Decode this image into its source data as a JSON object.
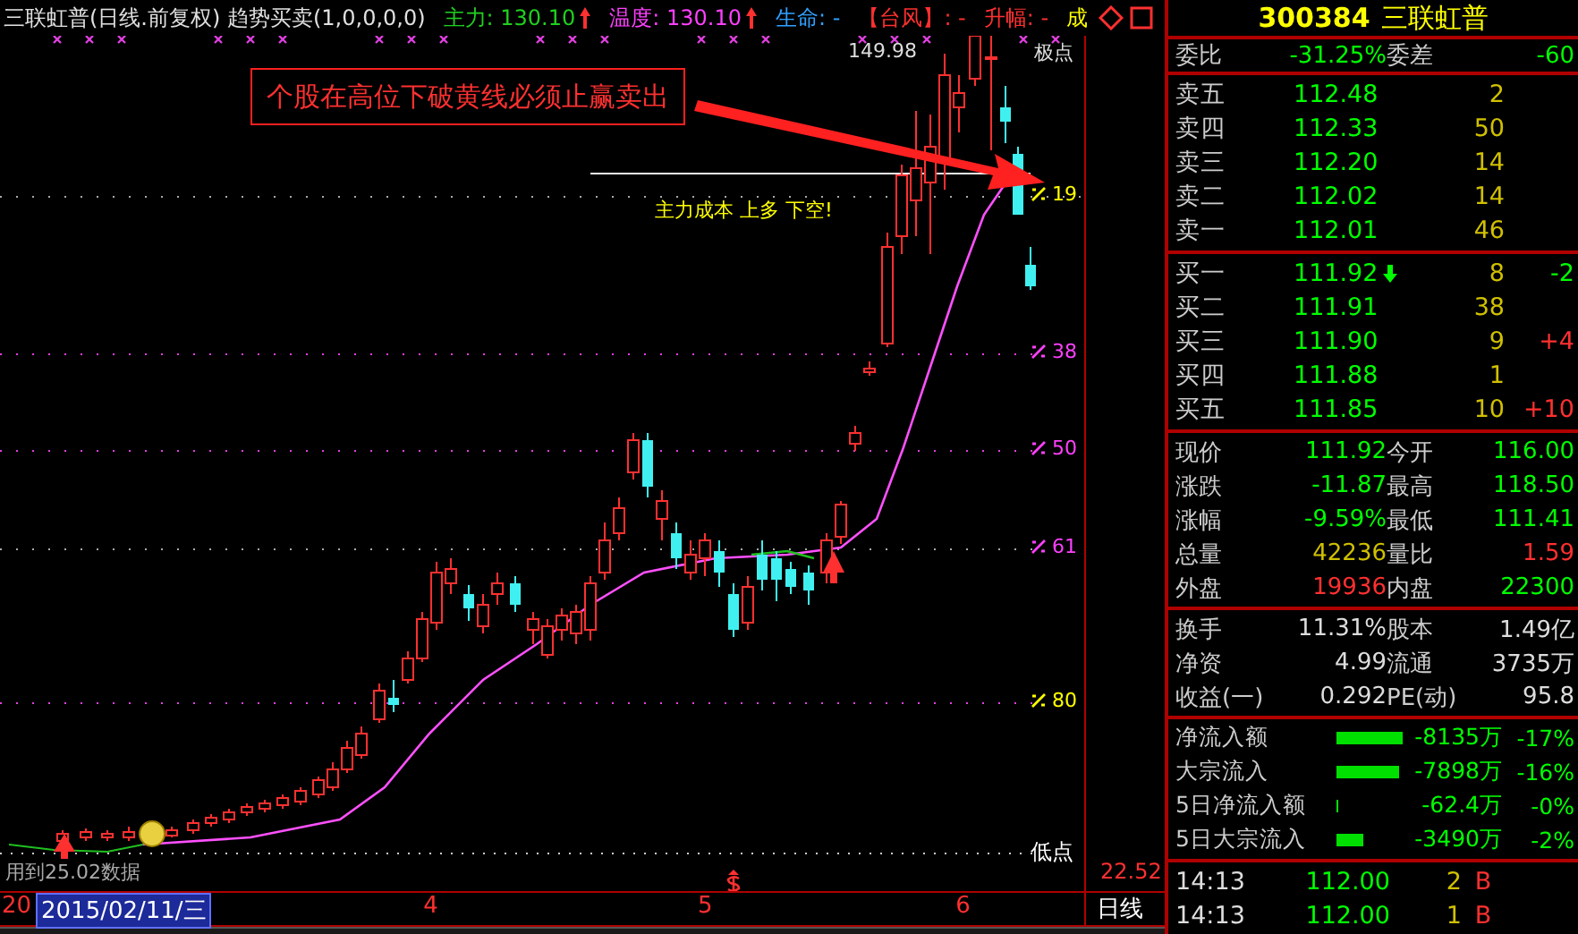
{
  "chart": {
    "title_items": [
      {
        "kind": "name",
        "text": "三联虹普(日线.前复权) 趋势买卖(1,0,0,0,0)",
        "rising": false
      },
      {
        "kind": "main",
        "text": "主力: 130.10",
        "rising": true
      },
      {
        "kind": "temp",
        "text": "温度: 130.10",
        "rising": true
      },
      {
        "kind": "life",
        "text": "生命: -",
        "rising": false
      },
      {
        "kind": "typhoon",
        "text": "【台风】: -",
        "rising": false
      },
      {
        "kind": "rise",
        "text": "升幅: -",
        "rising": false
      },
      {
        "kind": "vol",
        "text": "成",
        "rising": false
      }
    ],
    "callout": "个股在高位下破黄线必须止赢卖出",
    "cost_note": "主力成本 上多 下空!",
    "high_label": "149.98",
    "top_label": "极点",
    "low_label": "低点",
    "low_price": "22.52",
    "data_note": "用到25.02数据",
    "levels": [
      {
        "label": "19"
      },
      {
        "label": "38"
      },
      {
        "label": "50"
      },
      {
        "label": "61"
      },
      {
        "label": "80"
      }
    ],
    "axis": {
      "start": "20",
      "selected_date": "2015/02/11/三",
      "months": [
        "4",
        "5",
        "6"
      ],
      "period": "日线"
    }
  },
  "quote": {
    "code": "300384",
    "name": "三联虹普",
    "ratio": [
      {
        "label": "委比",
        "value": "-31.25%"
      },
      {
        "label": "委差",
        "value": "-60"
      }
    ],
    "asks": [
      {
        "label": "卖五",
        "price": "112.48",
        "volume": "2"
      },
      {
        "label": "卖四",
        "price": "112.33",
        "volume": "50"
      },
      {
        "label": "卖三",
        "price": "112.20",
        "volume": "14"
      },
      {
        "label": "卖二",
        "price": "112.02",
        "volume": "14"
      },
      {
        "label": "卖一",
        "price": "112.01",
        "volume": "46"
      }
    ],
    "bids": [
      {
        "label": "买一",
        "price": "111.92",
        "volume": "8",
        "falling": true,
        "change": "-2",
        "color": "#00ff00"
      },
      {
        "label": "买二",
        "price": "111.91",
        "volume": "38",
        "falling": false
      },
      {
        "label": "买三",
        "price": "111.90",
        "volume": "9",
        "falling": false,
        "change": "+4",
        "color": "#ff3030"
      },
      {
        "label": "买四",
        "price": "111.88",
        "volume": "1",
        "falling": false
      },
      {
        "label": "买五",
        "price": "111.85",
        "volume": "10",
        "falling": false,
        "change": "+10",
        "color": "#ff3030"
      }
    ],
    "stats": [
      {
        "cells": [
          {
            "label": "现价",
            "value": "111.92",
            "color": "#00ff00"
          },
          {
            "label": "今开",
            "value": "116.00",
            "color": "#00ff00"
          }
        ]
      },
      {
        "cells": [
          {
            "label": "涨跌",
            "value": "-11.87",
            "color": "#00ff00"
          },
          {
            "label": "最高",
            "value": "118.50",
            "color": "#00ff00"
          }
        ]
      },
      {
        "cells": [
          {
            "label": "涨幅",
            "value": "-9.59%",
            "color": "#00ff00"
          },
          {
            "label": "最低",
            "value": "111.41",
            "color": "#00ff00"
          }
        ]
      },
      {
        "cells": [
          {
            "label": "总量",
            "value": "42236",
            "color": "#d0c000"
          },
          {
            "label": "量比",
            "value": "1.59",
            "color": "#ff3030"
          }
        ]
      },
      {
        "cells": [
          {
            "label": "外盘",
            "value": "19936",
            "color": "#ff3030"
          },
          {
            "label": "内盘",
            "value": "22300",
            "color": "#00ff00"
          }
        ]
      }
    ],
    "fundamentals": [
      {
        "label": "换手",
        "value": "11.31%",
        "label2": "股本",
        "value2": "1.49亿"
      },
      {
        "label": "净资",
        "value": "4.99",
        "label2": "流通",
        "value2": "3735万"
      },
      {
        "label": "收益(一)",
        "value": "0.292",
        "label2": "PE(动)",
        "value2": "95.8"
      }
    ],
    "flows": [
      {
        "label": "净流入额",
        "amount": "-8135万",
        "percent": "-17%"
      },
      {
        "label": "大宗流入",
        "amount": "-7898万",
        "percent": "-16%"
      },
      {
        "label": "5日净流入额",
        "amount": "-62.4万",
        "percent": "-0%"
      },
      {
        "label": "5日大宗流入",
        "amount": "-3490万",
        "percent": "-2%"
      }
    ],
    "ticks": [
      {
        "time": "14:13",
        "price": "112.00",
        "volume": "2",
        "side": "B"
      },
      {
        "time": "14:13",
        "price": "112.00",
        "volume": "1",
        "side": "B"
      }
    ]
  }
}
